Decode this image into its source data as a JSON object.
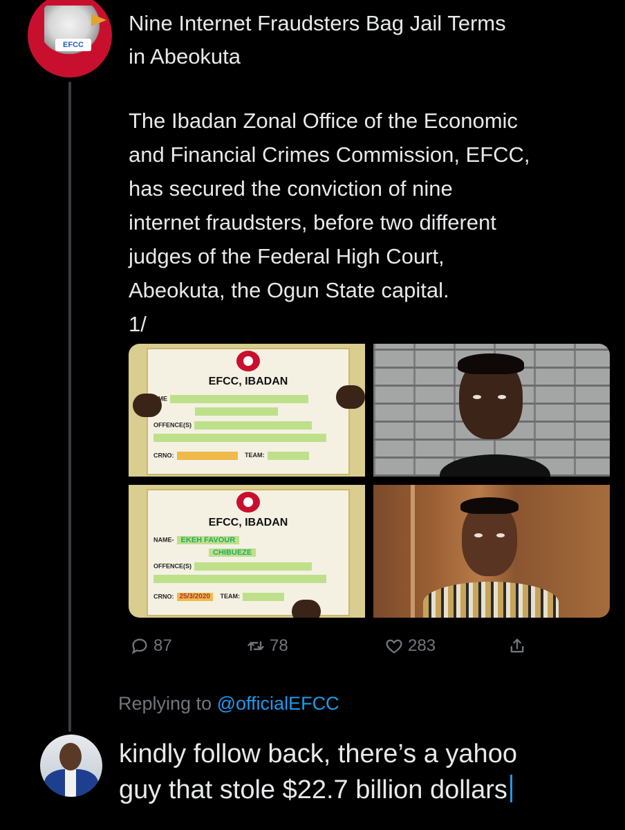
{
  "tweet": {
    "avatar_label": "EFCC",
    "title_lines": [
      "Nine Internet Fraudsters Bag Jail Terms",
      "in Abeokuta"
    ],
    "body_lines": [
      "The Ibadan Zonal Office of the Economic",
      "and Financial Crimes Commission, EFCC,",
      "has secured the conviction of nine",
      "internet fraudsters, before two different",
      "judges of the Federal High Court,",
      "Abeokuta, the Ogun State capital.",
      "1/"
    ],
    "media": {
      "placard_1": {
        "title": "EFCC, IBADAN",
        "name_label": "AME",
        "offence_label": "OFFENCE(S)",
        "crno_label": "CRNO:",
        "team_label": "TEAM:"
      },
      "placard_2": {
        "title": "EFCC, IBADAN",
        "name_label": "NAME-",
        "name_value": "EKEH FAVOUR",
        "name_value_2": "CHIBUEZE",
        "offence_label": "OFFENCE(S)",
        "crno_label": "CRNO:",
        "crno_value": "25/3/2020",
        "team_label": "TEAM:"
      }
    },
    "actions": {
      "reply_count": "87",
      "retweet_count": "78",
      "like_count": "283"
    }
  },
  "reply": {
    "replying_prefix": "Replying to",
    "replying_handle": "@officialEFCC",
    "text_lines": [
      "kindly follow back, there’s a yahoo",
      "guy that stole $22.7 billion dollars"
    ]
  },
  "colors": {
    "background": "#000000",
    "text": "#e7e9ea",
    "muted": "#71767b",
    "accent": "#1d9bf0",
    "efcc_red": "#c8102e"
  },
  "icons": [
    "reply-icon",
    "retweet-icon",
    "like-icon",
    "share-icon",
    "eagle-icon"
  ]
}
